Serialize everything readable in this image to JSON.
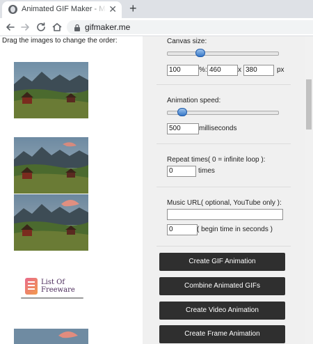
{
  "browser": {
    "tab_title": "Animated GIF Maker - Make GIFs",
    "tab_close": "✕",
    "new_tab": "+",
    "url": "gifmaker.me"
  },
  "page": {
    "instruction": "Drag the images to change the order:",
    "logo": {
      "line1": "List Of",
      "line2": "Freeware"
    },
    "canvas": {
      "label": "Canvas size:",
      "slider_level": 0.28,
      "percent_value": "100",
      "percent_unit": "%:",
      "width_value": "460",
      "times_sep": "x",
      "height_value": "380",
      "px_unit": "px"
    },
    "speed": {
      "label": "Animation speed:",
      "slider_level": 0.1,
      "value": "500",
      "unit": "milliseconds"
    },
    "repeat": {
      "label": "Repeat times( 0 = infinite loop ):",
      "value": "0",
      "unit": "times"
    },
    "music": {
      "label": "Music URL( optional, YouTube only ):",
      "url_value": "",
      "begin_value": "0",
      "begin_unit": "( begin time in seconds )"
    },
    "buttons": {
      "create_gif": "Create GIF Animation",
      "combine_gifs": "Combine Animated GIFs",
      "create_video": "Create Video Animation",
      "create_frame": "Create Frame Animation"
    }
  },
  "icons": {
    "back": "arrow-left-icon",
    "forward": "arrow-right-icon",
    "reload": "reload-icon",
    "home": "home-icon",
    "lock": "lock-icon"
  }
}
